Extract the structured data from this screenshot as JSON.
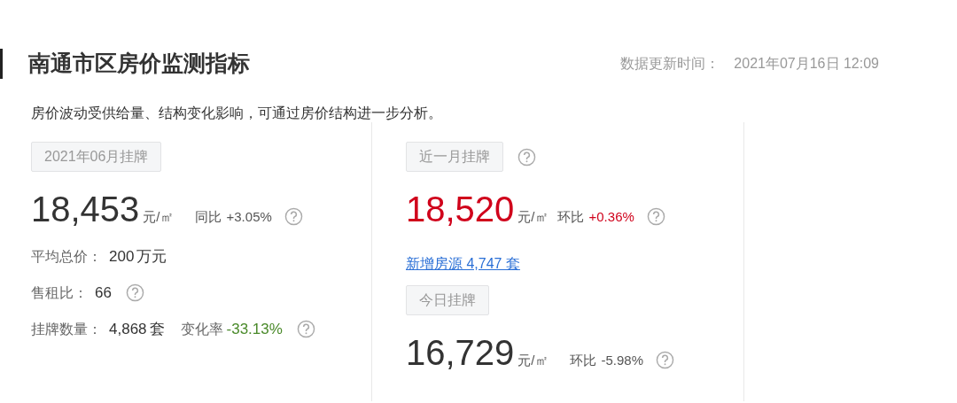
{
  "title": "南通市区房价监测指标",
  "updated": {
    "label": "数据更新时间：",
    "value": "2021年07月16日 12:09"
  },
  "description": "房价波动受供给量、结构变化影响，可通过房价结构进一步分析。",
  "panels": [
    {
      "sections": [
        {
          "tag": "2021年06月挂牌",
          "tag_help": false,
          "price": {
            "value": "18,453",
            "color": "#333333"
          },
          "unit": "元/㎡",
          "change": {
            "label": "同比",
            "value": "+3.05%",
            "color": "#555555",
            "help": true
          },
          "stats": [
            {
              "label": "平均总价：",
              "value": "200",
              "unit": "万元",
              "help": false
            },
            {
              "label": "售租比：",
              "value": "66",
              "help": true
            },
            {
              "label": "挂牌数量：",
              "value": "4,868",
              "unit": "套",
              "change": {
                "label": "变化率",
                "value": "-33.13%",
                "color": "#4a8a2a"
              },
              "help": true
            }
          ]
        }
      ]
    },
    {
      "sections": [
        {
          "tag": "近一月挂牌",
          "tag_help": true,
          "price": {
            "value": "18,520",
            "color": "#d0021b"
          },
          "unit": "元/㎡",
          "change": {
            "label": "环比",
            "value": "+0.36%",
            "color": "#d0021b",
            "help": true
          },
          "link": "新增房源 4,747 套"
        },
        {
          "tag": "今日挂牌",
          "tag_help": false,
          "price": {
            "value": "16,729",
            "color": "#333333"
          },
          "unit": "元/㎡",
          "change": {
            "label": "环比",
            "value": "-5.98%",
            "color": "#555555",
            "help": true
          }
        }
      ]
    }
  ]
}
